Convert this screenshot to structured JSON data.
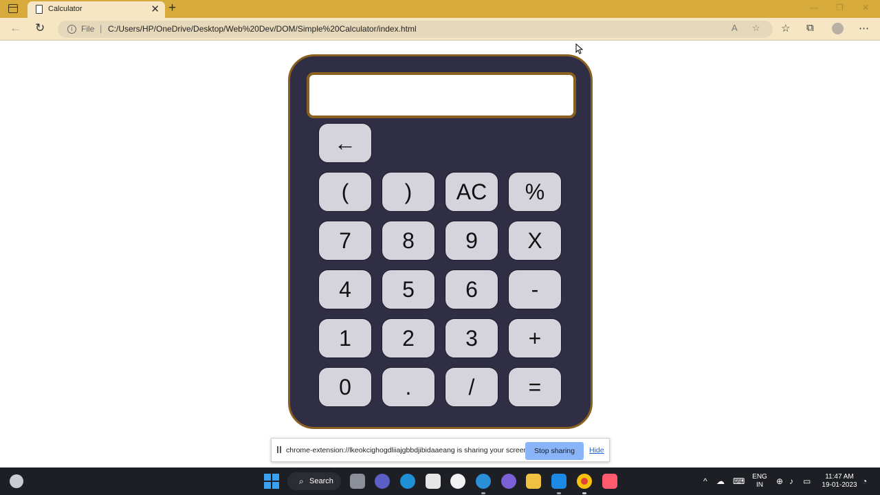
{
  "browser": {
    "tab_title": "Calculator",
    "tab_close": "✕",
    "new_tab": "+",
    "address_prefix": "File",
    "address_separator": "|",
    "url": "C:/Users/HP/OneDrive/Desktop/Web%20Dev/DOM/Simple%20Calculator/index.html"
  },
  "calculator": {
    "display_value": "",
    "backspace_label": "←",
    "keys": [
      "(",
      ")",
      "AC",
      "%",
      "7",
      "8",
      "9",
      "X",
      "4",
      "5",
      "6",
      "-",
      "1",
      "2",
      "3",
      "+",
      "0",
      ".",
      "/",
      "="
    ],
    "colors": {
      "body": "#2f2e45",
      "border": "#8a6020",
      "key": "#d5d3dc"
    }
  },
  "share_bar": {
    "message": "chrome-extension://lkeokcighogdliiajgbbdjibidaaeang is sharing your screen.",
    "stop_label": "Stop sharing",
    "hide_label": "Hide"
  },
  "taskbar": {
    "search_label": "Search",
    "language_line1": "ENG",
    "language_line2": "IN",
    "time": "11:47 AM",
    "date": "19-01-2023"
  }
}
